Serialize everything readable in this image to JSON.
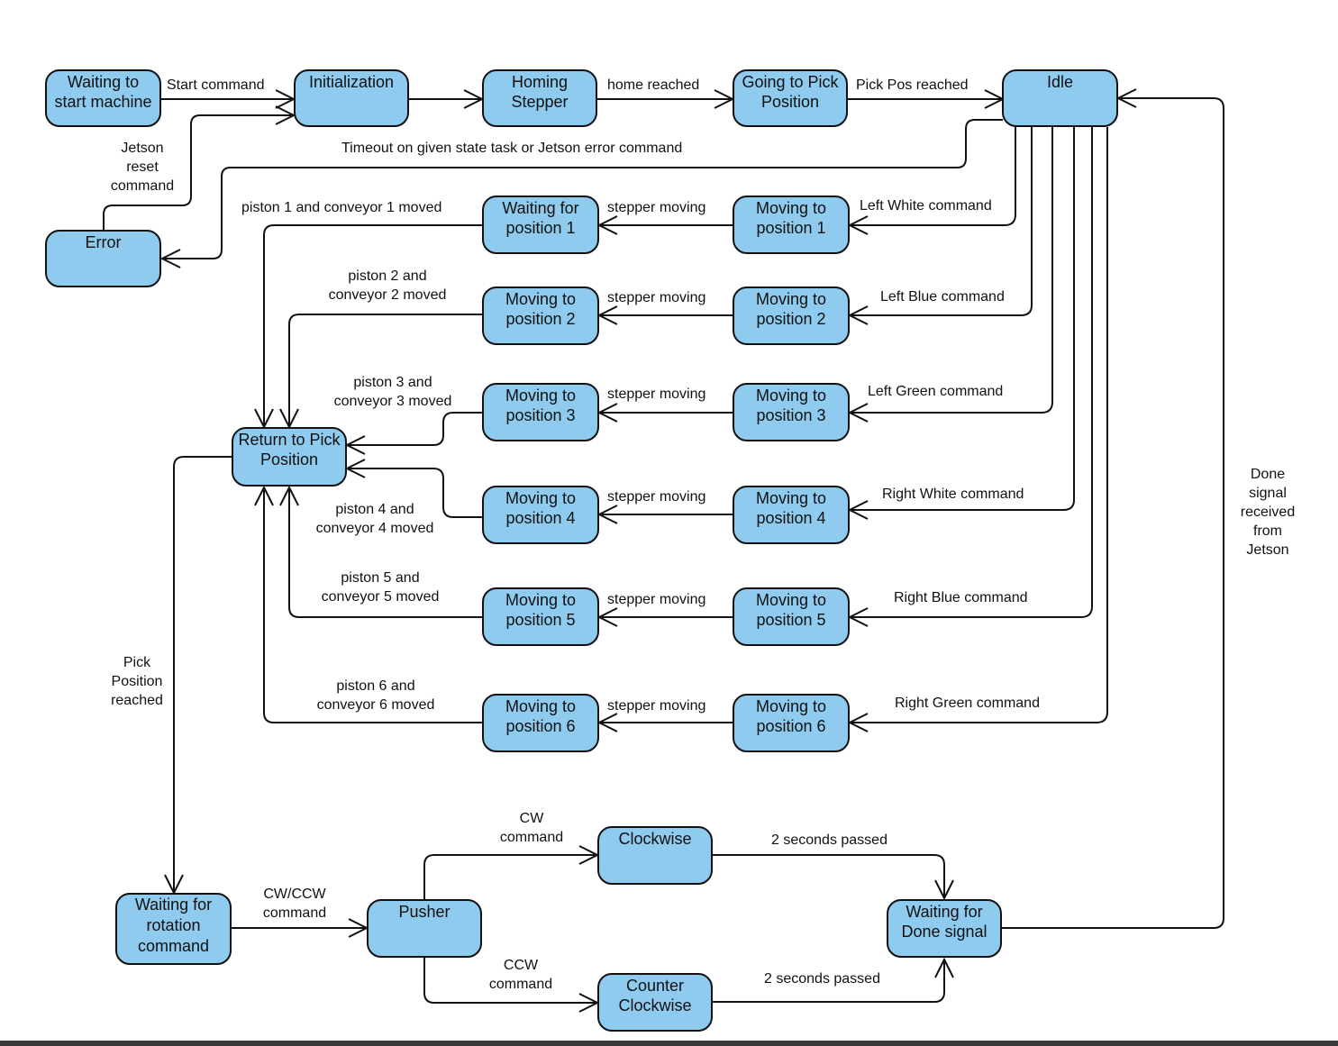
{
  "diagram": {
    "type": "state-machine",
    "fill_color": "#8ecbef",
    "stroke_color": "#111111",
    "states": {
      "waiting_start": "Waiting to\nstart machine",
      "initialization": "Initialization",
      "homing": "Homing\nStepper",
      "going_pick": "Going to Pick\nPosition",
      "idle": "Idle",
      "error": "Error",
      "wait_pos1": "Waiting for\nposition 1",
      "move_pos1": "Moving to\nposition 1",
      "move2_pos2": "Moving to\nposition 2",
      "move_pos2": "Moving to\nposition 2",
      "move2_pos3": "Moving to\nposition 3",
      "move_pos3": "Moving to\nposition 3",
      "move2_pos4": "Moving to\nposition 4",
      "move_pos4": "Moving to\nposition 4",
      "move2_pos5": "Moving to\nposition 5",
      "move_pos5": "Moving to\nposition 5",
      "move2_pos6": "Moving to\nposition 6",
      "move_pos6": "Moving to\nposition 6",
      "return_pick": "Return to Pick\nPosition",
      "wait_rotation": "Waiting for\nrotation\ncommand",
      "pusher": "Pusher",
      "clockwise": "Clockwise",
      "counter_clockwise": "Counter\nClockwise",
      "wait_done": "Waiting for\nDone signal"
    },
    "transitions": {
      "start_command": "Start command",
      "home_reached": "home reached",
      "pick_pos_reached": "Pick Pos reached",
      "jetson_reset": "Jetson\nreset\ncommand",
      "timeout_error": "Timeout on given state task or Jetson error command",
      "left_white": "Left White command",
      "left_blue": "Left Blue command",
      "left_green": "Left Green command",
      "right_white": "Right White command",
      "right_blue": "Right Blue command",
      "right_green": "Right Green command",
      "stepper_moving_1": "stepper moving",
      "stepper_moving_2": "stepper moving",
      "stepper_moving_3": "stepper moving",
      "stepper_moving_4": "stepper moving",
      "stepper_moving_5": "stepper moving",
      "stepper_moving_6": "stepper moving",
      "piston1": "piston 1 and conveyor 1 moved",
      "piston2": "piston 2 and\nconveyor 2 moved",
      "piston3": "piston 3 and\nconveyor 3 moved",
      "piston4": "piston 4 and\nconveyor 4 moved",
      "piston5": "piston 5 and\nconveyor 5 moved",
      "piston6": "piston 6 and\nconveyor 6 moved",
      "pick_position_reached": "Pick\nPosition\nreached",
      "cw_ccw_command": "CW/CCW\ncommand",
      "cw_command": "CW\ncommand",
      "ccw_command": "CCW\ncommand",
      "two_sec_cw": "2 seconds passed",
      "two_sec_ccw": "2 seconds passed",
      "done_signal": "Done\nsignal\nreceived\nfrom\nJetson"
    }
  }
}
